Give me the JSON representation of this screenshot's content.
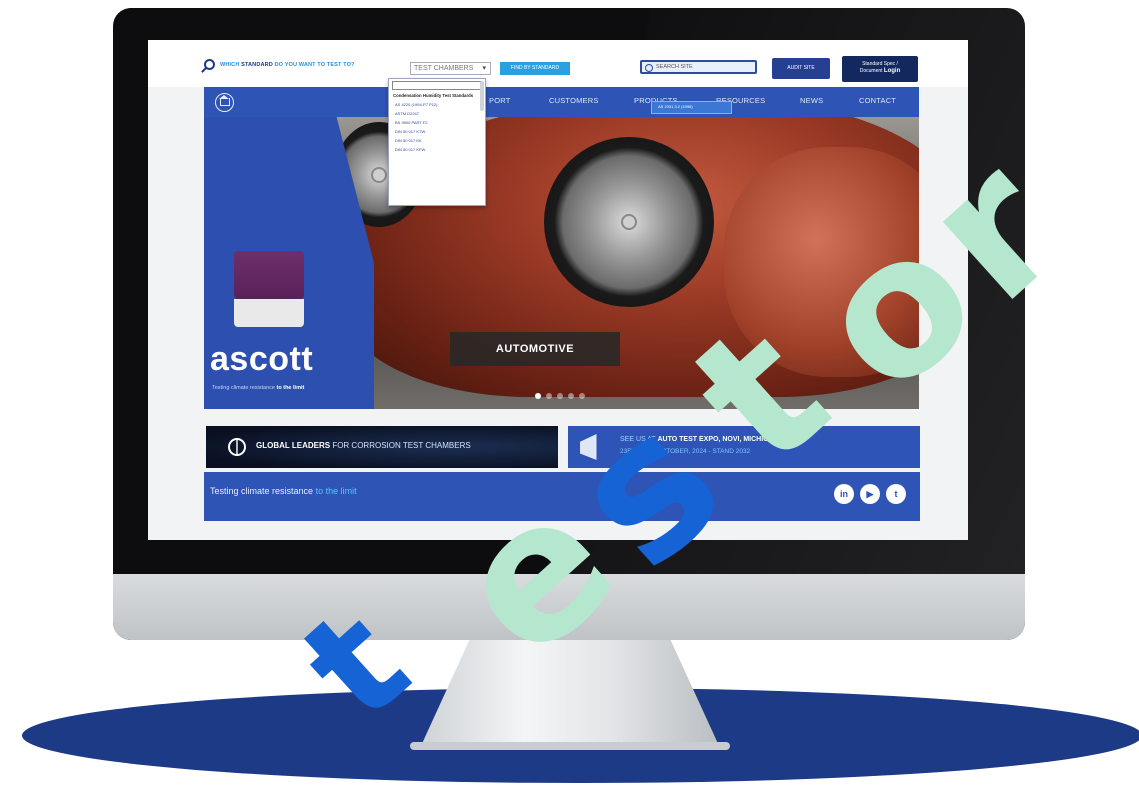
{
  "top_bar": {
    "standard_prompt_prefix": "WHICH",
    "standard_prompt_bold": "STANDARD",
    "standard_prompt_suffix": "DO YOU WANT TO TEST TO?",
    "test_chambers_select": "TEST CHAMBERS",
    "find_button": "FIND BY STANDARD",
    "site_search_placeholder": "SEARCH SITE",
    "audit_button": "AUDIT SITE",
    "login_line1": "Standard Spec /",
    "login_line2_prefix": "Document",
    "login_line2_bold": "Login"
  },
  "dropdown": {
    "group_label": "Condensation Humidity Test Standards",
    "items": [
      "AS 2331.3.2 (1998)",
      "AS 4220 (1994-P7 P12)",
      "ASTM D2247",
      "BS 3900 PART F2",
      "DIN 50 017 KTW",
      "DIN 50 017 KK",
      "DIN 50 017 KFW"
    ]
  },
  "nav": {
    "items": [
      "PORT",
      "CUSTOMERS",
      "PRODUCTS",
      "RESOURCES",
      "NEWS",
      "CONTACT"
    ]
  },
  "hero": {
    "brand": "ascott",
    "tagline_prefix": "Testing climate resistance",
    "tagline_bold": "to the limit",
    "caption": "AUTOMOTIVE",
    "slide_count": 5,
    "active_slide": 1
  },
  "banners": {
    "left_bold": "GLOBAL LEADERS",
    "left_rest": "FOR CORROSION TEST CHAMBERS",
    "right_line1_prefix": "SEE US AT",
    "right_line1_bold": "AUTO TEST EXPO, NOVI, MICHIGAN",
    "right_line2": "23RD-25TH OCTOBER, 2024 - STAND 2032"
  },
  "footer": {
    "text_prefix": "Testing climate resistance",
    "text_highlight": "to the limit",
    "social": [
      "in",
      "▶",
      "t"
    ]
  },
  "watermark": {
    "letters": [
      "t",
      "e",
      "s",
      "t",
      "o",
      "r"
    ],
    "colors": {
      "blue": "#1663d6",
      "green": "#b5e7cf"
    }
  },
  "colors": {
    "nav_blue": "#2e54b5",
    "accent_cyan": "#2aa0df",
    "base_blue": "#1c3a86"
  }
}
